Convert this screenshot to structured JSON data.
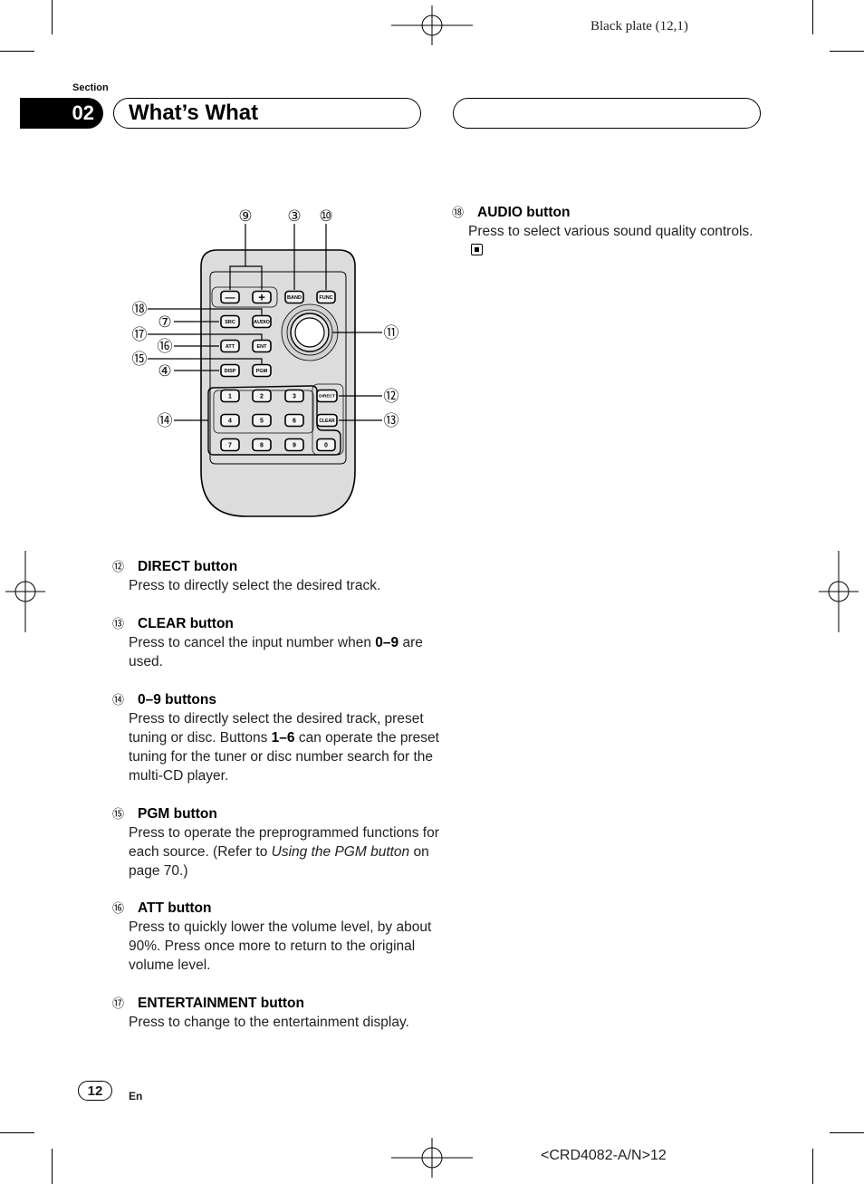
{
  "header": {
    "plate_text": "Black plate (12,1)",
    "section_label": "Section",
    "section_number": "02",
    "section_title": "What’s What"
  },
  "diagram": {
    "callouts": [
      {
        "id": "9",
        "glyph": "⑨"
      },
      {
        "id": "3",
        "glyph": "③"
      },
      {
        "id": "10",
        "glyph": "⑩"
      },
      {
        "id": "18",
        "glyph": "⑱"
      },
      {
        "id": "7",
        "glyph": "⑦"
      },
      {
        "id": "17",
        "glyph": "⑰"
      },
      {
        "id": "16",
        "glyph": "⑯"
      },
      {
        "id": "15",
        "glyph": "⑮"
      },
      {
        "id": "4",
        "glyph": "④"
      },
      {
        "id": "14",
        "glyph": "⑭"
      },
      {
        "id": "11",
        "glyph": "⑪"
      },
      {
        "id": "12",
        "glyph": "⑫"
      },
      {
        "id": "13",
        "glyph": "⑬"
      }
    ],
    "buttons": {
      "minus": "—",
      "plus": "+",
      "band": "BAND",
      "func": "FUNC",
      "src": "SRC",
      "audio": "AUDIO",
      "att": "ATT",
      "ent": "ENT",
      "disp": "DISP",
      "pgm": "PGM",
      "direct": "DIRECT",
      "clear": "CLEAR",
      "digits": [
        "1",
        "2",
        "3",
        "4",
        "5",
        "6",
        "7",
        "8",
        "9",
        "0"
      ]
    }
  },
  "items_left": [
    {
      "num": "⑫",
      "title": "DIRECT button",
      "body": "Press to directly select the desired track."
    },
    {
      "num": "⑬",
      "title": "CLEAR button",
      "body_pre": "Press to cancel the input number when ",
      "body_bold": "0–9",
      "body_post": " are used."
    },
    {
      "num": "⑭",
      "title": "0–9 buttons",
      "body_pre": "Press to directly select the desired track, preset tuning or disc. Buttons ",
      "body_bold": "1–6",
      "body_post": " can operate the preset tuning for the tuner or disc number search for the multi-CD player."
    },
    {
      "num": "⑮",
      "title": "PGM button",
      "body_pre": "Press to operate the preprogrammed functions for each source. (Refer to ",
      "body_italic": "Using the PGM button",
      "body_post": " on page 70.)"
    },
    {
      "num": "⑯",
      "title": "ATT button",
      "body": "Press to quickly lower the volume level, by about 90%. Press once more to return to the original volume level."
    },
    {
      "num": "⑰",
      "title": "ENTERTAINMENT button",
      "body": "Press to change to the entertainment display."
    }
  ],
  "items_right": [
    {
      "num": "⑱",
      "title": "AUDIO button",
      "body": "Press to select various sound quality controls."
    }
  ],
  "footer": {
    "page_number": "12",
    "language": "En",
    "doc_code": "<CRD4082-A/N>12"
  }
}
